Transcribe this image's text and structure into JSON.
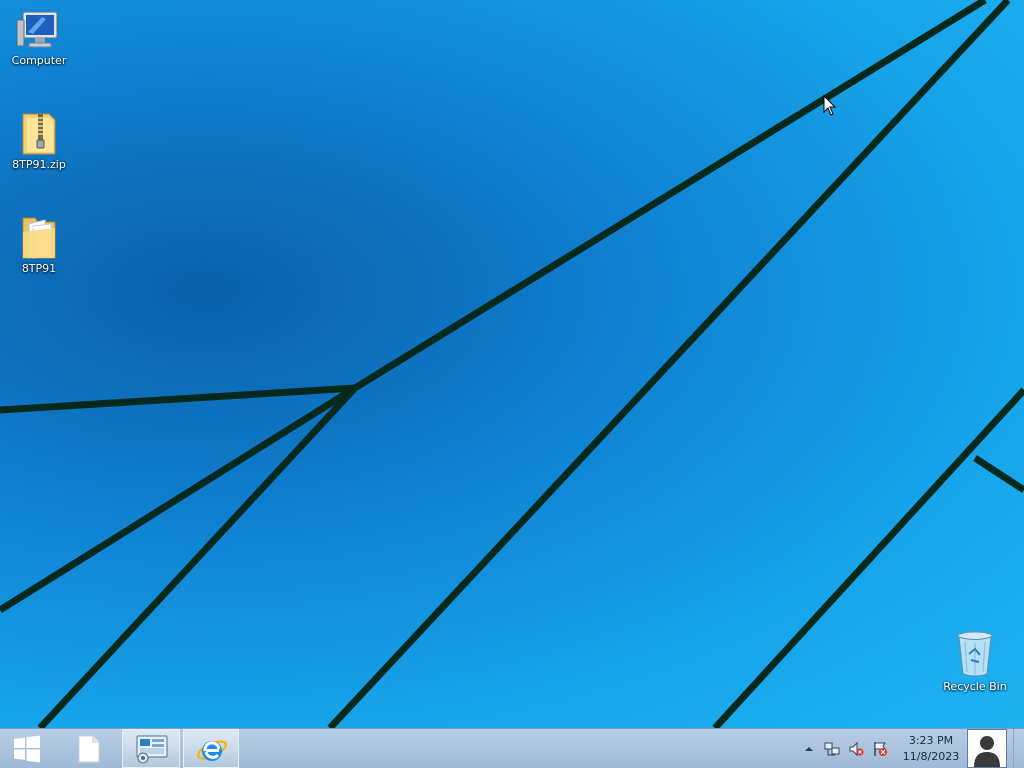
{
  "desktop": {
    "icons": [
      {
        "label": "Computer",
        "icon": "computer-icon"
      },
      {
        "label": "8TP91.zip",
        "icon": "zip-folder-icon"
      },
      {
        "label": "8TP91",
        "icon": "folder-icon"
      },
      {
        "label": "Recycle Bin",
        "icon": "recycle-bin-icon"
      }
    ]
  },
  "taskbar": {
    "start_icon": "windows-logo-icon",
    "pinned": [
      {
        "icon": "file-icon"
      },
      {
        "icon": "server-manager-icon",
        "active": true
      },
      {
        "icon": "internet-explorer-icon",
        "active": true
      }
    ],
    "tray": {
      "icons": [
        "chevron-up-icon",
        "network-icon",
        "speaker-muted-icon",
        "action-center-flag-icon"
      ]
    },
    "clock": {
      "time": "3:23 PM",
      "date": "11/8/2023"
    }
  },
  "colors": {
    "wallpaper_light": "#1fb3f3",
    "wallpaper_dark": "#0a5fa8",
    "taskbar": "#a8c2dd",
    "lines": "#062a1f"
  }
}
